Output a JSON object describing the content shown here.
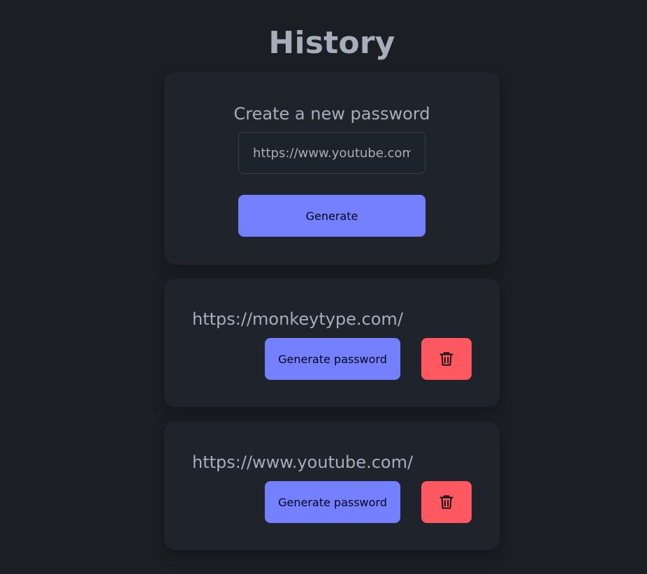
{
  "page": {
    "title": "History"
  },
  "create": {
    "title": "Create a new password",
    "input_value": "https://www.youtube.com/",
    "generate_label": "Generate"
  },
  "history": {
    "items": [
      {
        "url": "https://monkeytype.com/",
        "generate_label": "Generate password",
        "delete_icon": "trash-icon"
      },
      {
        "url": "https://www.youtube.com/",
        "generate_label": "Generate password",
        "delete_icon": "trash-icon"
      }
    ]
  },
  "colors": {
    "background": "#1b1e23",
    "card": "#1f232a",
    "text": "#a6adbb",
    "primary": "#7480ff",
    "danger": "#ff5861"
  }
}
